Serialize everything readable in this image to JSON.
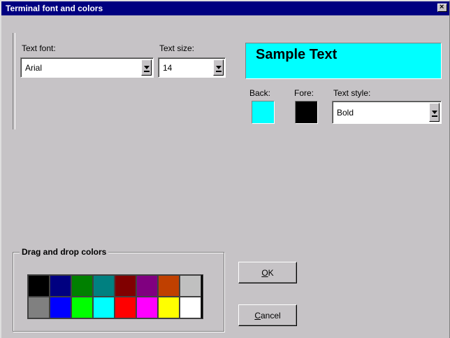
{
  "window": {
    "title": "Terminal font and colors",
    "close_icon": "close-icon"
  },
  "text_font": {
    "label": "Text font:",
    "value": "Arial"
  },
  "text_size": {
    "label": "Text size:",
    "value": "14"
  },
  "sample": {
    "text": "Sample Text",
    "background": "#00ffff",
    "foreground": "#000000"
  },
  "back": {
    "label": "Back:",
    "color": "#00ffff"
  },
  "fore": {
    "label": "Fore:",
    "color": "#000000"
  },
  "text_style": {
    "label": "Text style:",
    "value": "Bold"
  },
  "palette": {
    "label": "Drag and drop colors",
    "rows": [
      [
        "#000000",
        "#000080",
        "#008000",
        "#008080",
        "#800000",
        "#800080",
        "#c04000",
        "#c0c0c0"
      ],
      [
        "#808080",
        "#0000ff",
        "#00ff00",
        "#00ffff",
        "#ff0000",
        "#ff00ff",
        "#ffff00",
        "#ffffff"
      ]
    ]
  },
  "buttons": {
    "ok": "OK",
    "cancel": "Cancel"
  }
}
